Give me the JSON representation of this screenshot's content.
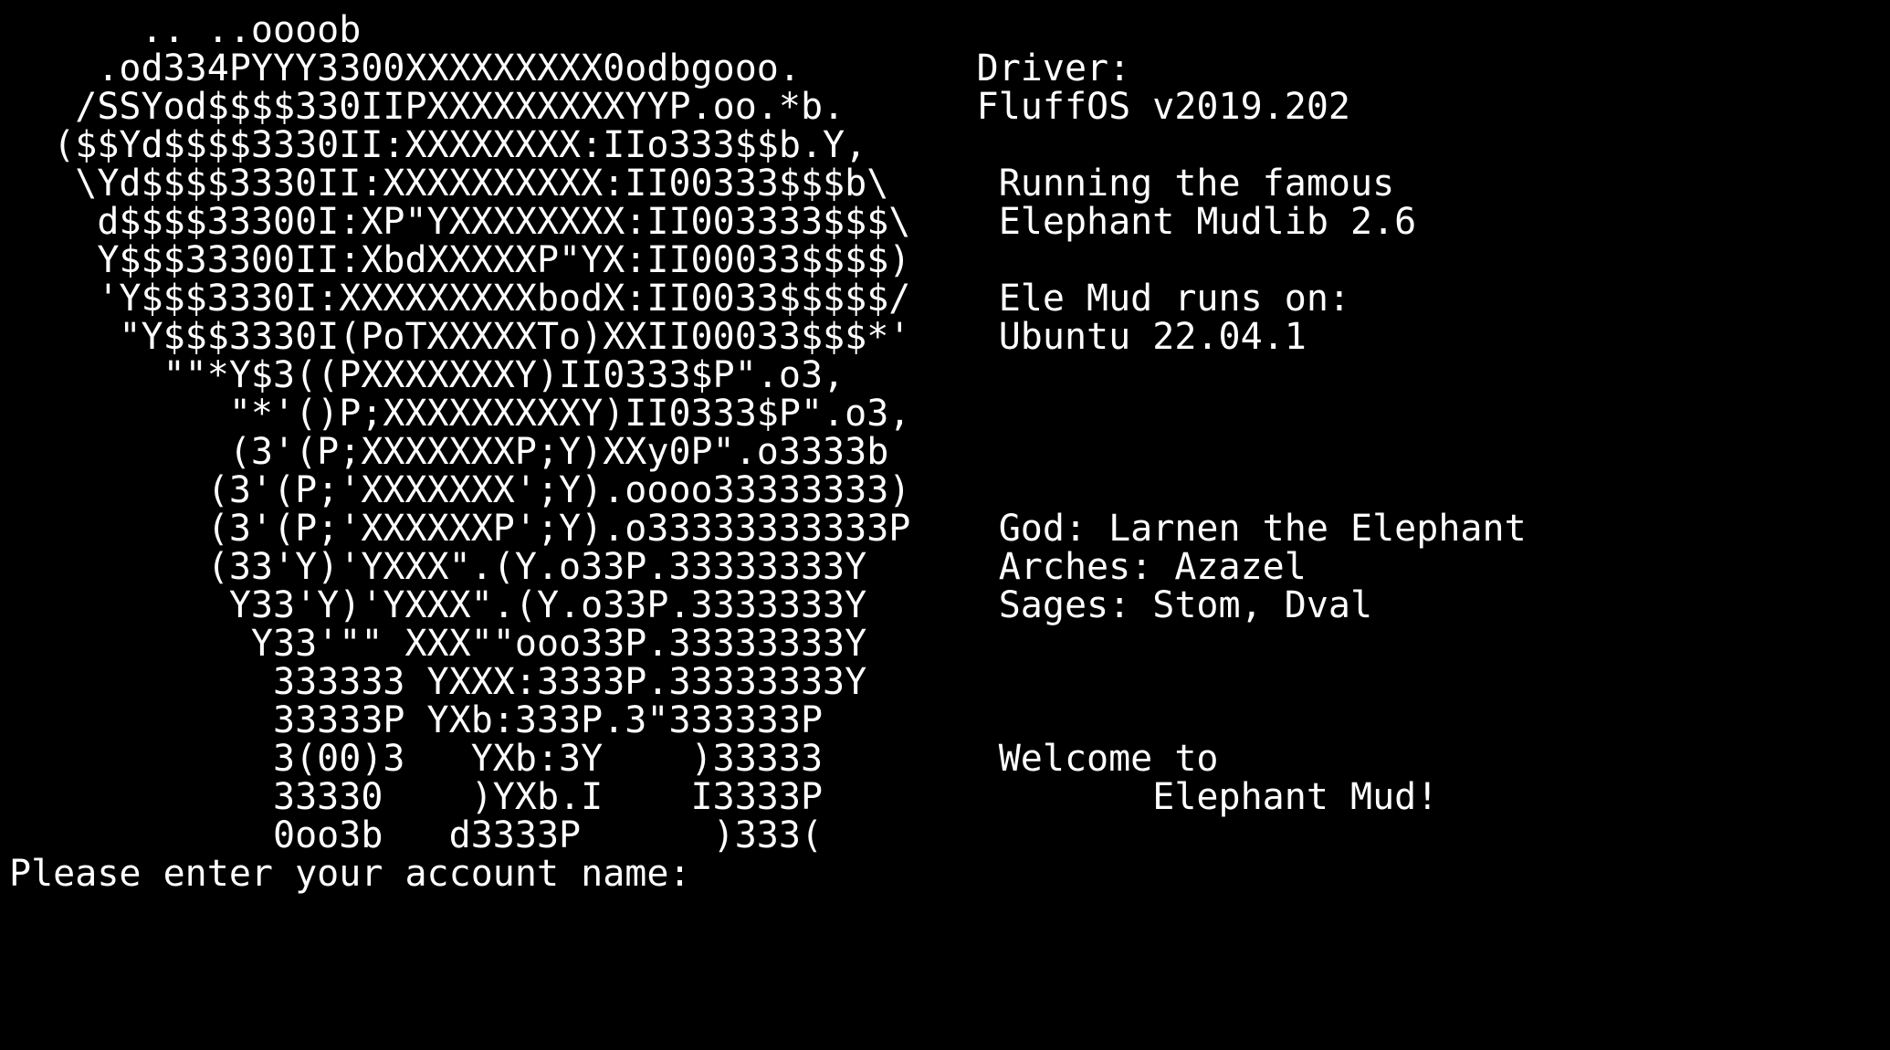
{
  "terminal": {
    "background": "#000000",
    "foreground": "#ffffff",
    "lines": [
      "      .. ..oooob",
      "    .od334PYYY3300XXXXXXXXX0odbgooo.        Driver:",
      "   /SSYod$$$$330IIPXXXXXXXXXYYP.oo.*b.      FluffOS v2019.202",
      "  ($$Yd$$$$3330II:XXXXXXXX:IIo333$$b.Y,",
      "   \\Yd$$$$3330II:XXXXXXXXXX:II00333$$$b\\     Running the famous",
      "    d$$$$33300I:XP\"YXXXXXXXX:II003333$$$\\    Elephant Mudlib 2.6",
      "    Y$$$33300II:XbdXXXXXP\"YX:II00033$$$$)",
      "    'Y$$$3330I:XXXXXXXXXbodX:II0033$$$$$/    Ele Mud runs on:",
      "     \"Y$$$3330I(PoTXXXXXTo)XXII00033$$$*'    Ubuntu 22.04.1",
      "       \"\"*Y$3((PXXXXXXXY)II0333$P\".o3,",
      "          \"*'()P;XXXXXXXXXY)II0333$P\".o3,",
      "          (3'(P;XXXXXXXP;Y)XXy0P\".o3333b",
      "         (3'(P;'XXXXXXX';Y).oooo33333333)",
      "         (3'(P;'XXXXXXP';Y).o33333333333P    God: Larnen the Elephant",
      "         (33'Y)'YXXX\".(Y.o33P.33333333Y      Arches: Azazel",
      "          Y33'Y)'YXXX\".(Y.o33P.3333333Y      Sages: Stom, Dval",
      "           Y33'\"\" XXX\"\"ooo33P.33333333Y",
      "            333333 YXXX:3333P.33333333Y",
      "            33333P YXb:333P.3\"333333P",
      "            3(00)3   YXb:3Y    )33333        Welcome to",
      "            33330    )YXb.I    I3333P               Elephant Mud!",
      "            0oo3b   d3333P      )333(",
      "Please enter your account name: "
    ]
  }
}
